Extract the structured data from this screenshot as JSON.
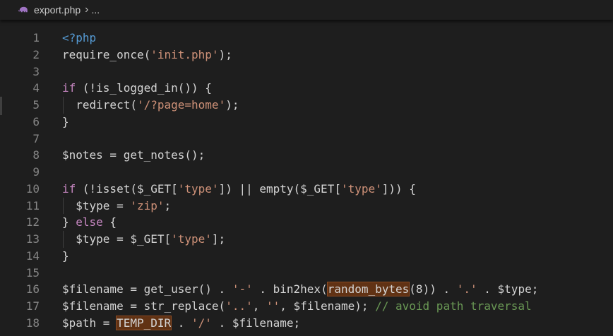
{
  "breadcrumb": {
    "file_icon": "php-elephant-icon",
    "file_name": "export.php",
    "separator": "›",
    "more": "..."
  },
  "colors": {
    "background": "#1e1e1e",
    "line_number": "#858585",
    "default_text": "#d4d4d4",
    "keyword": "#c586c0",
    "php_tag": "#569cd6",
    "string": "#ce9178",
    "comment": "#6a9955",
    "highlight": "#613214"
  },
  "editor": {
    "lines": [
      {
        "n": "1",
        "tokens": [
          {
            "t": "<?php",
            "c": "t"
          }
        ]
      },
      {
        "n": "2",
        "tokens": [
          {
            "t": "require_once(",
            "c": "v"
          },
          {
            "t": "'init.php'",
            "c": "s"
          },
          {
            "t": ");",
            "c": "v"
          }
        ]
      },
      {
        "n": "3",
        "tokens": []
      },
      {
        "n": "4",
        "tokens": [
          {
            "t": "if",
            "c": "k"
          },
          {
            "t": " (!is_logged_in()) {",
            "c": "v"
          }
        ]
      },
      {
        "n": "5",
        "guide": true,
        "tokens": [
          {
            "t": "  redirect(",
            "c": "v"
          },
          {
            "t": "'/?page=home'",
            "c": "s"
          },
          {
            "t": ");",
            "c": "v"
          }
        ]
      },
      {
        "n": "6",
        "tokens": [
          {
            "t": "}",
            "c": "v"
          }
        ]
      },
      {
        "n": "7",
        "tokens": []
      },
      {
        "n": "8",
        "tokens": [
          {
            "t": "$notes = get_notes();",
            "c": "v"
          }
        ]
      },
      {
        "n": "9",
        "tokens": []
      },
      {
        "n": "10",
        "tokens": [
          {
            "t": "if",
            "c": "k"
          },
          {
            "t": " (!isset($_GET[",
            "c": "v"
          },
          {
            "t": "'type'",
            "c": "s"
          },
          {
            "t": "]) || empty($_GET[",
            "c": "v"
          },
          {
            "t": "'type'",
            "c": "s"
          },
          {
            "t": "])) {",
            "c": "v"
          }
        ]
      },
      {
        "n": "11",
        "guide": true,
        "tokens": [
          {
            "t": "  $type = ",
            "c": "v"
          },
          {
            "t": "'zip'",
            "c": "s"
          },
          {
            "t": ";",
            "c": "v"
          }
        ]
      },
      {
        "n": "12",
        "tokens": [
          {
            "t": "} ",
            "c": "v"
          },
          {
            "t": "else",
            "c": "k"
          },
          {
            "t": " {",
            "c": "v"
          }
        ]
      },
      {
        "n": "13",
        "guide": true,
        "tokens": [
          {
            "t": "  $type = $_GET[",
            "c": "v"
          },
          {
            "t": "'type'",
            "c": "s"
          },
          {
            "t": "];",
            "c": "v"
          }
        ]
      },
      {
        "n": "14",
        "tokens": [
          {
            "t": "}",
            "c": "v"
          }
        ]
      },
      {
        "n": "15",
        "tokens": []
      },
      {
        "n": "16",
        "tokens": [
          {
            "t": "$filename = get_user() . ",
            "c": "v"
          },
          {
            "t": "'-'",
            "c": "s"
          },
          {
            "t": " . bin2hex(",
            "c": "v"
          },
          {
            "t": "random_bytes",
            "c": "v",
            "hl": true
          },
          {
            "t": "(8)) . ",
            "c": "v"
          },
          {
            "t": "'.'",
            "c": "s"
          },
          {
            "t": " . $type;",
            "c": "v"
          }
        ]
      },
      {
        "n": "17",
        "tokens": [
          {
            "t": "$filename = str_replace(",
            "c": "v"
          },
          {
            "t": "'..'",
            "c": "s"
          },
          {
            "t": ", ",
            "c": "v"
          },
          {
            "t": "''",
            "c": "s"
          },
          {
            "t": ", $filename); ",
            "c": "v"
          },
          {
            "t": "// avoid path traversal",
            "c": "c"
          }
        ]
      },
      {
        "n": "18",
        "tokens": [
          {
            "t": "$path = ",
            "c": "v"
          },
          {
            "t": "TEMP_DIR",
            "c": "v",
            "hl": true
          },
          {
            "t": " . ",
            "c": "v"
          },
          {
            "t": "'/'",
            "c": "s"
          },
          {
            "t": " . $filename;",
            "c": "v"
          }
        ]
      }
    ]
  }
}
